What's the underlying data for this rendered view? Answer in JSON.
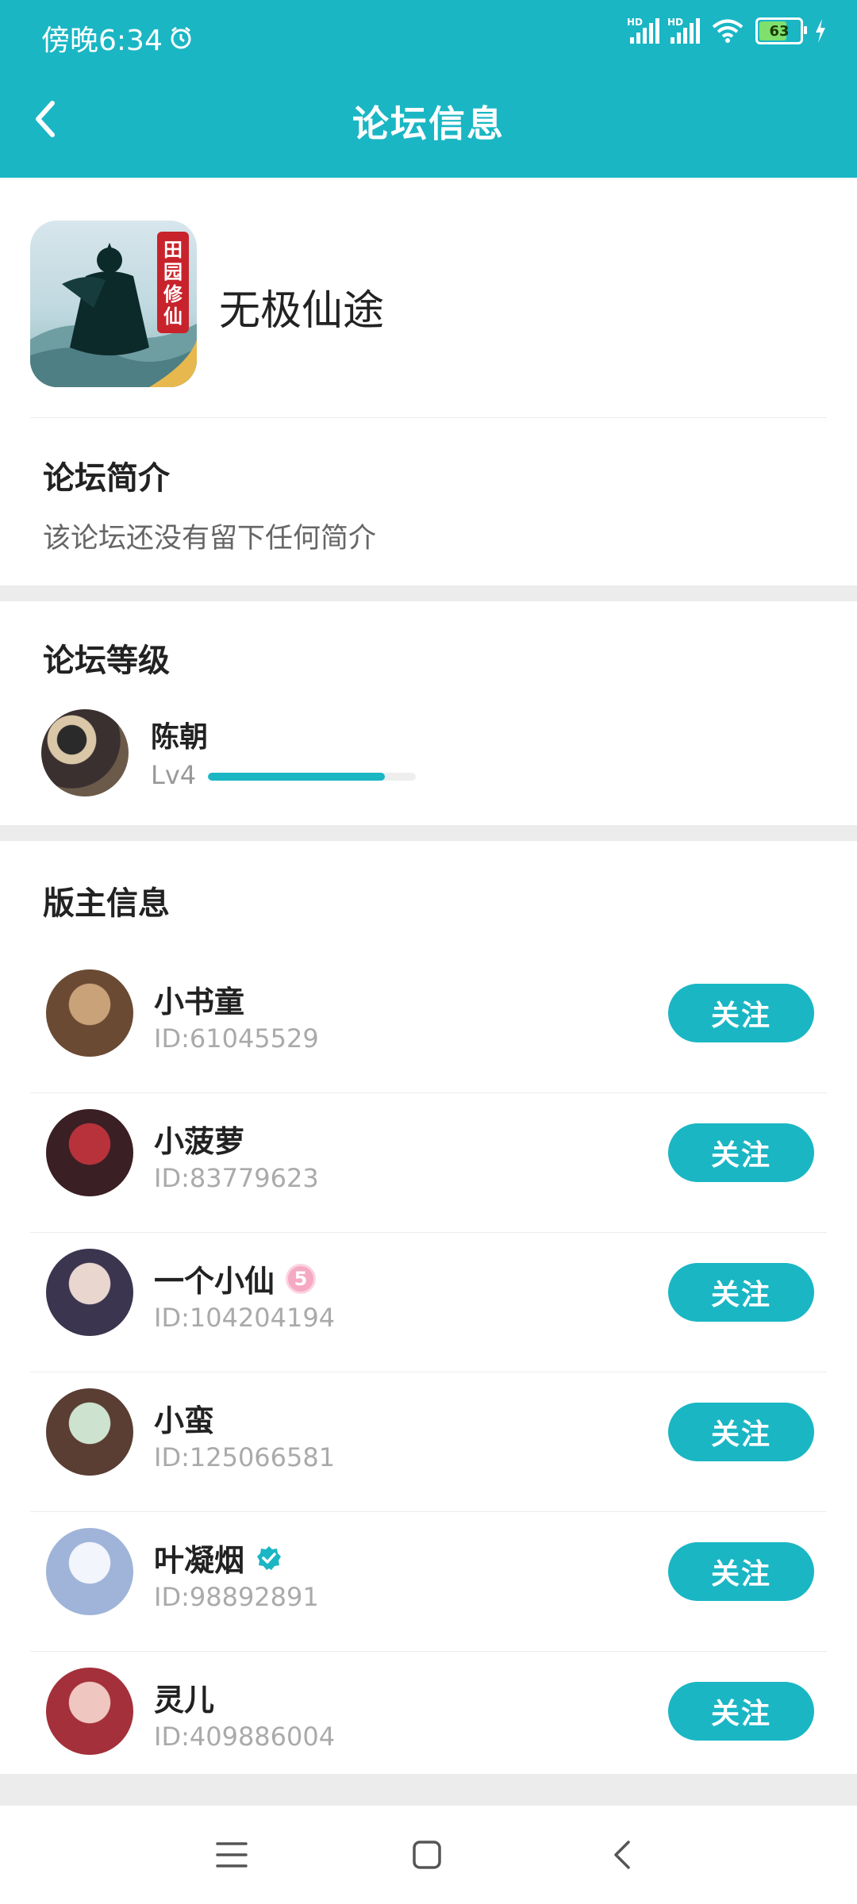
{
  "status_bar": {
    "time": "傍晚6:34",
    "battery": "63",
    "signal_label": "HD"
  },
  "header": {
    "title": "论坛信息"
  },
  "forum": {
    "name": "无极仙途",
    "icon_badge": "田园修仙",
    "intro_title": "论坛简介",
    "intro_text": "该论坛还没有留下任何简介"
  },
  "level": {
    "section_title": "论坛等级",
    "user_name": "陈朝",
    "level_text": "Lv4",
    "progress_fraction": 0.85
  },
  "moderators": {
    "section_title": "版主信息",
    "follow_label": "关注",
    "items": [
      {
        "name": "小书童",
        "id": "ID:61045529",
        "badge": "",
        "color_a": "#6b4a33",
        "color_b": "#c9a27a"
      },
      {
        "name": "小菠萝",
        "id": "ID:83779623",
        "badge": "",
        "color_a": "#3a1f24",
        "color_b": "#b8323c"
      },
      {
        "name": "一个小仙",
        "id": "ID:104204194",
        "badge": "level-5",
        "badge_text": "5",
        "color_a": "#3b3550",
        "color_b": "#e8d6cf"
      },
      {
        "name": "小蛮",
        "id": "ID:125066581",
        "badge": "",
        "color_a": "#5a3d33",
        "color_b": "#cde3cf"
      },
      {
        "name": "叶凝烟",
        "id": "ID:98892891",
        "badge": "verified",
        "color_a": "#9fb4d8",
        "color_b": "#f2f5fb"
      },
      {
        "name": "灵儿",
        "id": "ID:409886004",
        "badge": "",
        "color_a": "#a3303a",
        "color_b": "#f0c6c0"
      }
    ]
  },
  "colors": {
    "accent": "#1ab6c4",
    "background": "#ececec"
  }
}
